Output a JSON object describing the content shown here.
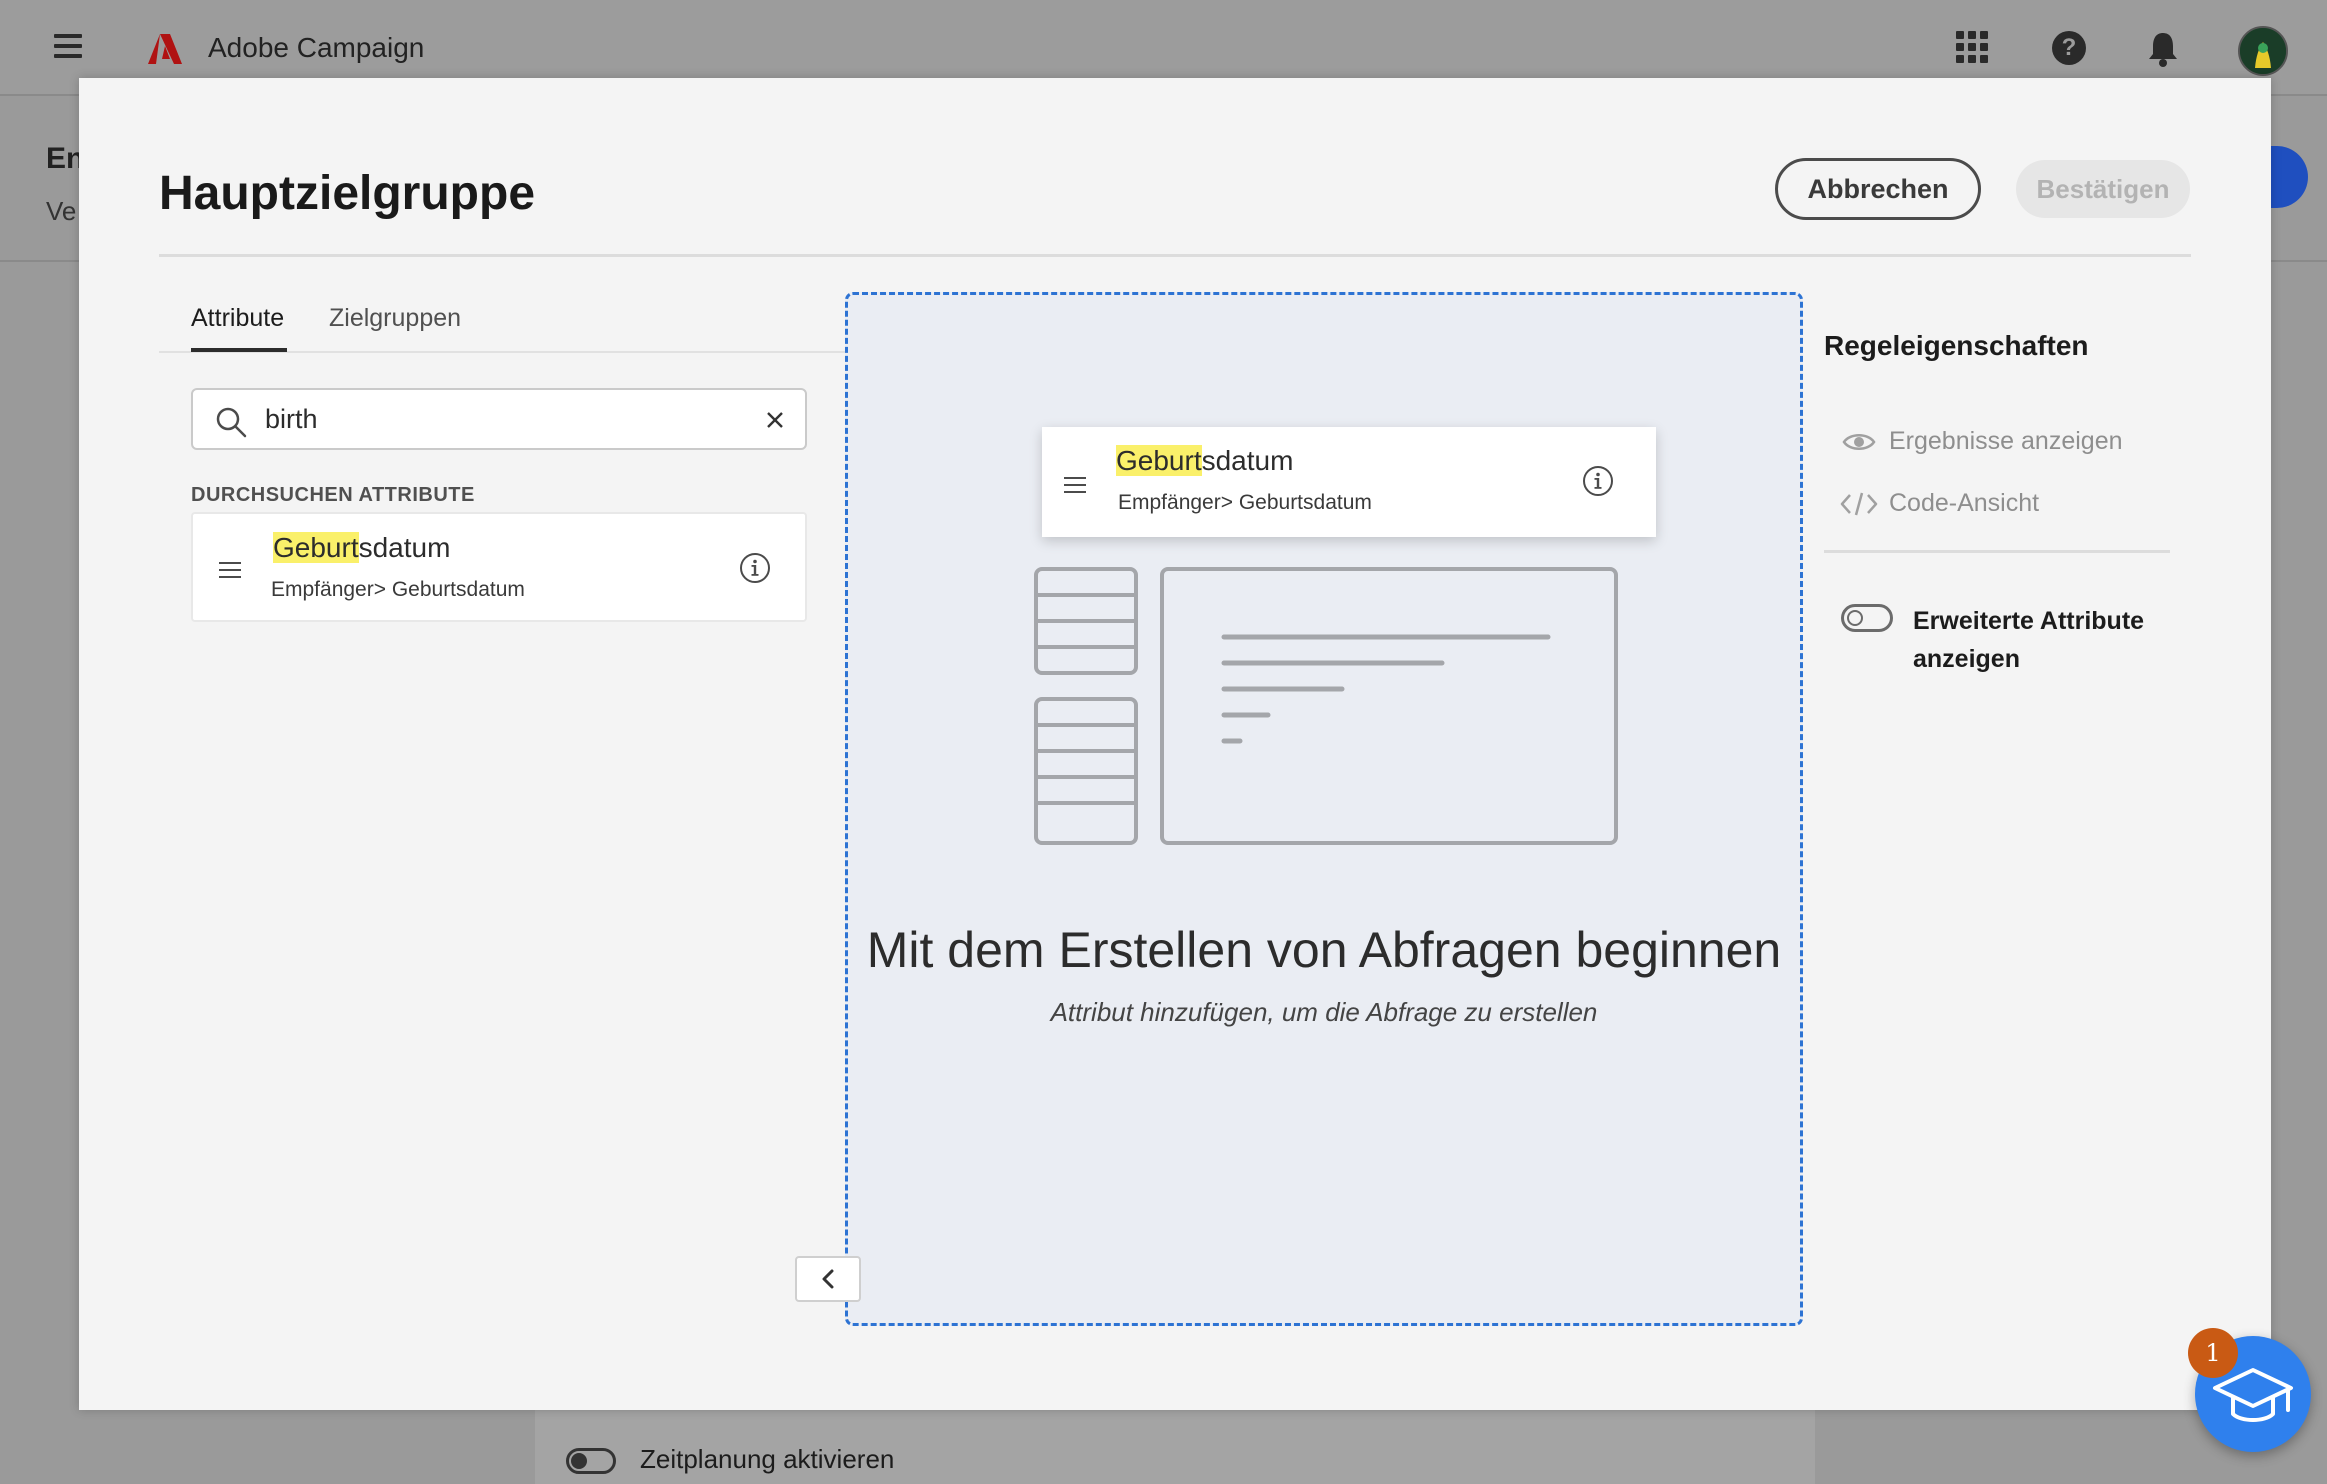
{
  "app": {
    "title": "Adobe Campaign"
  },
  "background": {
    "page_title": "En",
    "page_subtitle": "Ve",
    "schedule_toggle_label": "Zeitplanung aktivieren"
  },
  "modal": {
    "title": "Hauptzielgruppe",
    "cancel_label": "Abbrechen",
    "confirm_label": "Bestätigen",
    "tabs": [
      {
        "label": "Attribute",
        "active": true
      },
      {
        "label": "Zielgruppen",
        "active": false
      }
    ],
    "search": {
      "value": "birth"
    },
    "section_label": "DURCHSUCHEN ATTRIBUTE",
    "result": {
      "name_highlight": "Geburt",
      "name_rest": "sdatum",
      "path": "Empfänger> Geburtsdatum"
    },
    "canvas": {
      "drag_item": {
        "name_highlight": "Geburt",
        "name_rest": "sdatum",
        "path": "Empfänger> Geburtsdatum"
      },
      "title": "Mit dem Erstellen von Abfragen beginnen",
      "subtitle": "Attribut hinzufügen, um die Abfrage zu erstellen"
    },
    "rule_properties": {
      "title": "Regeleigenschaften",
      "show_results": "Ergebnisse anzeigen",
      "code_view": "Code-Ansicht",
      "advanced_toggle_label": "Erweiterte Attribute anzeigen"
    }
  },
  "help": {
    "badge_count": "1"
  },
  "colors": {
    "accent_blue": "#2d73d3",
    "highlight": "#faf06a",
    "fab_blue": "#2f80ed",
    "badge_orange": "#c95a14"
  },
  "icons": [
    "menu-icon",
    "adobe-logo-icon",
    "apps-grid-icon",
    "help-icon",
    "bell-icon",
    "search-icon",
    "clear-icon",
    "drag-handle-icon",
    "info-icon",
    "eye-icon",
    "code-icon",
    "chevron-left-icon",
    "graduation-cap-icon"
  ]
}
